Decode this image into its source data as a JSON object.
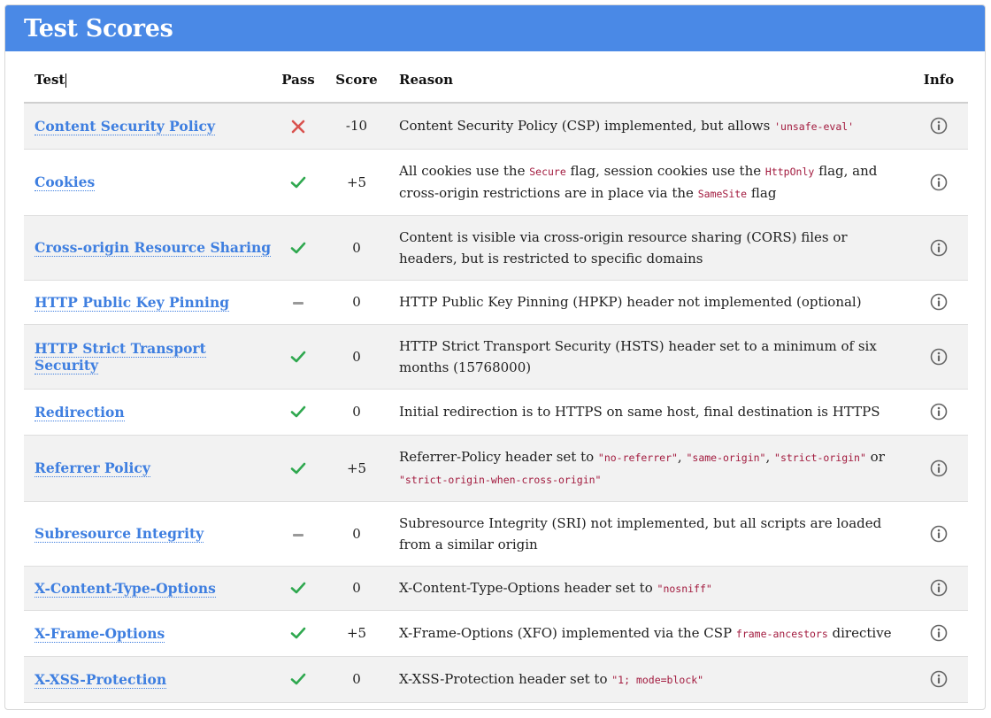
{
  "header": {
    "title": "Test Scores"
  },
  "table": {
    "columns": {
      "test": "Test",
      "pass": "Pass",
      "score": "Score",
      "reason": "Reason",
      "info": "Info"
    },
    "rows": [
      {
        "test": "Content Security Policy",
        "pass": "fail",
        "score": "-10",
        "reason": [
          {
            "t": "Content Security Policy (CSP) implemented, but allows "
          },
          {
            "c": "'unsafe-eval'"
          }
        ]
      },
      {
        "test": "Cookies",
        "pass": "pass",
        "score": "+5",
        "reason": [
          {
            "t": "All cookies use the "
          },
          {
            "c": "Secure"
          },
          {
            "t": " flag, session cookies use the "
          },
          {
            "c": "HttpOnly"
          },
          {
            "t": " flag, and cross-origin restrictions are in place via the "
          },
          {
            "c": "SameSite"
          },
          {
            "t": " flag"
          }
        ]
      },
      {
        "test": "Cross-origin Resource Sharing",
        "pass": "pass",
        "score": "0",
        "reason": [
          {
            "t": "Content is visible via cross-origin resource sharing (CORS) files or headers, but is restricted to specific domains"
          }
        ]
      },
      {
        "test": "HTTP Public Key Pinning",
        "pass": "neutral",
        "score": "0",
        "reason": [
          {
            "t": "HTTP Public Key Pinning (HPKP) header not implemented (optional)"
          }
        ]
      },
      {
        "test": "HTTP Strict Transport Security",
        "pass": "pass",
        "score": "0",
        "reason": [
          {
            "t": "HTTP Strict Transport Security (HSTS) header set to a minimum of six months (15768000)"
          }
        ]
      },
      {
        "test": "Redirection",
        "pass": "pass",
        "score": "0",
        "reason": [
          {
            "t": "Initial redirection is to HTTPS on same host, final destination is HTTPS"
          }
        ]
      },
      {
        "test": "Referrer Policy",
        "pass": "pass",
        "score": "+5",
        "reason": [
          {
            "t": "Referrer-Policy header set to "
          },
          {
            "c": "\"no-referrer\""
          },
          {
            "t": ", "
          },
          {
            "c": "\"same-origin\""
          },
          {
            "t": ", "
          },
          {
            "c": "\"strict-origin\""
          },
          {
            "t": " or "
          },
          {
            "c": "\"strict-origin-when-cross-origin\""
          }
        ]
      },
      {
        "test": "Subresource Integrity",
        "pass": "neutral",
        "score": "0",
        "reason": [
          {
            "t": "Subresource Integrity (SRI) not implemented, but all scripts are loaded from a similar origin"
          }
        ]
      },
      {
        "test": "X-Content-Type-Options",
        "pass": "pass",
        "score": "0",
        "reason": [
          {
            "t": "X-Content-Type-Options header set to "
          },
          {
            "c": "\"nosniff\""
          }
        ]
      },
      {
        "test": "X-Frame-Options",
        "pass": "pass",
        "score": "+5",
        "reason": [
          {
            "t": "X-Frame-Options (XFO) implemented via the CSP "
          },
          {
            "c": "frame-ancestors"
          },
          {
            "t": " directive"
          }
        ]
      },
      {
        "test": "X-XSS-Protection",
        "pass": "pass",
        "score": "0",
        "reason": [
          {
            "t": "X-XSS-Protection header set to "
          },
          {
            "c": "\"1; mode=block\""
          }
        ]
      }
    ]
  },
  "icons": {
    "pass": "checkmark-icon",
    "fail": "x-mark-icon",
    "neutral": "dash-icon",
    "info": "info-circle-icon"
  },
  "colors": {
    "header_bg": "#4a89e6",
    "link": "#3f7fe0",
    "pass": "#2fa84f",
    "fail": "#d9534f",
    "neutral": "#999999",
    "code": "#a21a3e",
    "stripe": "#f2f2f2"
  }
}
